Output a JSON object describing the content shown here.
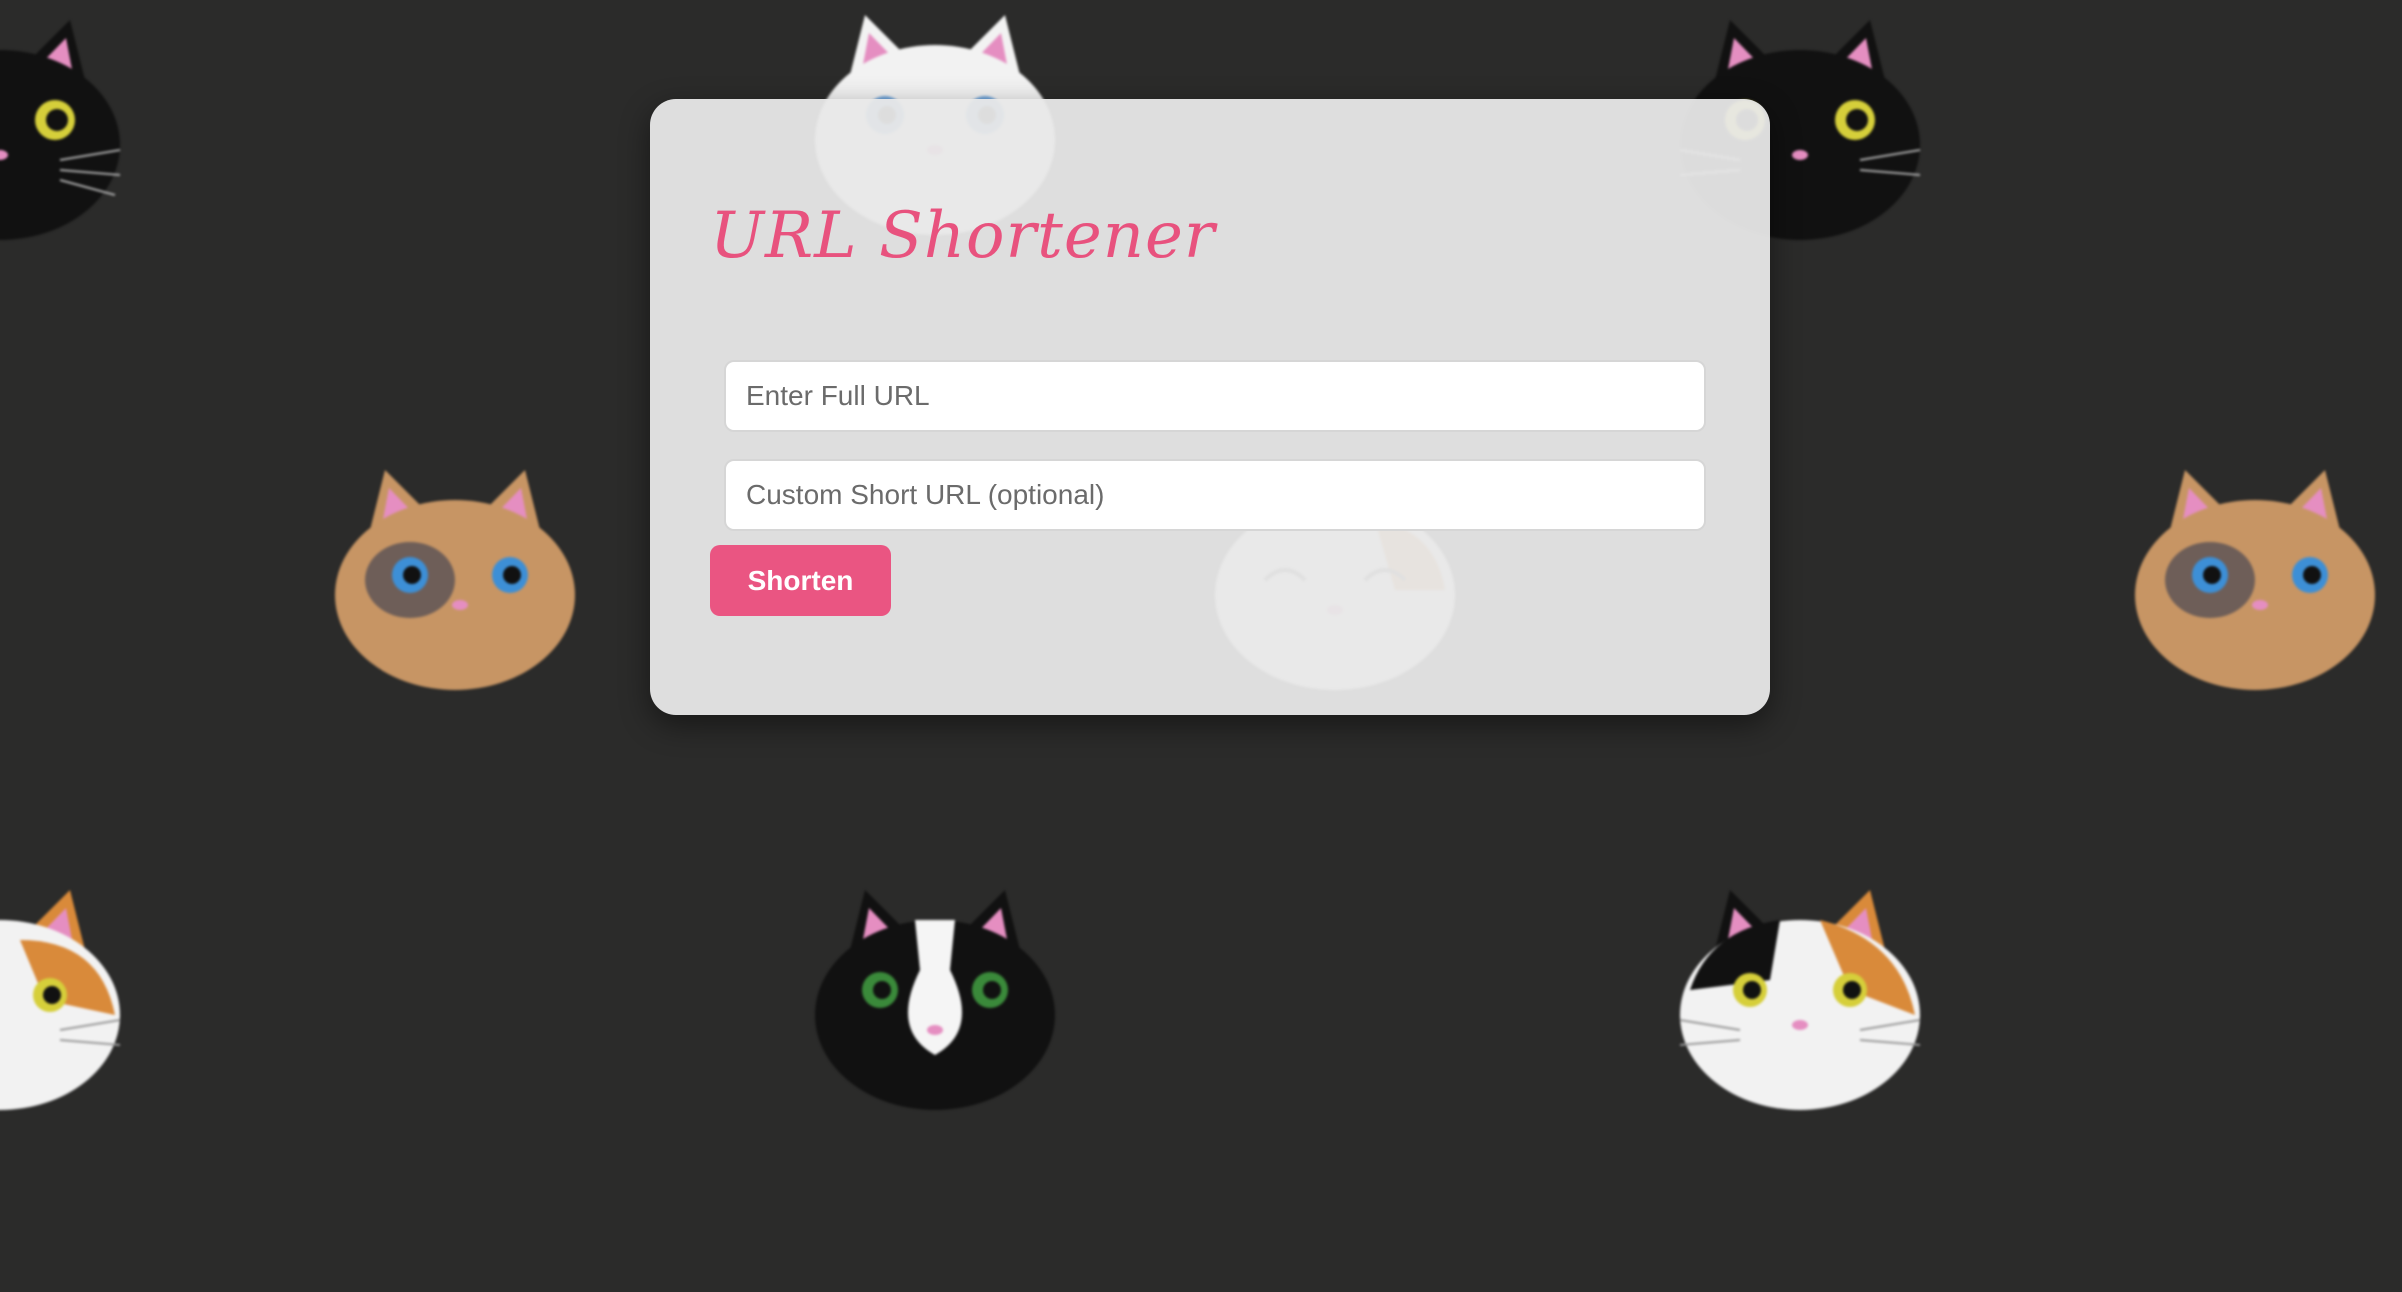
{
  "page": {
    "background_color": "#2b2b2a"
  },
  "background_cats": [
    {
      "name": "black-cat-head-icon",
      "color": "black"
    },
    {
      "name": "white-cat-head-icon",
      "color": "white"
    },
    {
      "name": "tabby-cat-head-icon",
      "color": "tabby"
    },
    {
      "name": "calico-cat-head-icon",
      "color": "calico"
    },
    {
      "name": "tuxedo-cat-head-icon",
      "color": "tuxedo"
    }
  ],
  "card": {
    "title": "URL Shortener",
    "full_url_placeholder": "Enter Full URL",
    "full_url_value": "",
    "custom_url_placeholder": "Custom Short URL (optional)",
    "custom_url_value": "",
    "submit_label": "Shorten"
  },
  "colors": {
    "accent": "#ea5582",
    "title": "#e8527e",
    "card_background": "#e8e8e8"
  }
}
